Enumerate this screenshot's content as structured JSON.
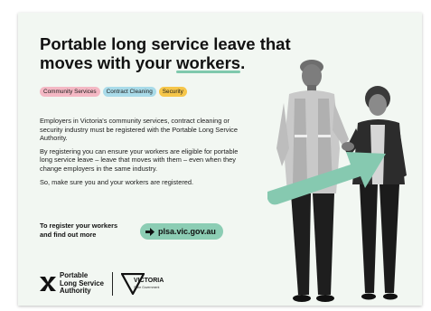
{
  "headline": {
    "line1": "Portable long service leave that",
    "line2_prefix": "moves with your ",
    "line2_highlight": "workers",
    "line2_suffix": "."
  },
  "tags": [
    {
      "label": "Community Services",
      "color": "#f4b8c4"
    },
    {
      "label": "Contract Cleaning",
      "color": "#a9dbe9"
    },
    {
      "label": "Security",
      "color": "#f6c64a"
    }
  ],
  "body": {
    "p1": "Employers in Victoria's community services, contract cleaning or security industry must be registered with the Portable Long Service Authority.",
    "p2": "By registering you can ensure your workers are eligible for portable long service leave – leave that moves with them – even when they change employers in the same industry.",
    "p3": "So, make sure you and your workers are registered."
  },
  "register": {
    "text_line1": "To register your workers",
    "text_line2": "and find out more",
    "url": "plsa.vic.gov.au"
  },
  "logos": {
    "plsa_line1": "Portable",
    "plsa_line2": "Long Service",
    "plsa_line3": "Authority",
    "vic_main": "VICTORIA",
    "vic_sub": "State Government"
  },
  "colors": {
    "accent": "#7fc9ad",
    "background": "#f2f7f2"
  }
}
